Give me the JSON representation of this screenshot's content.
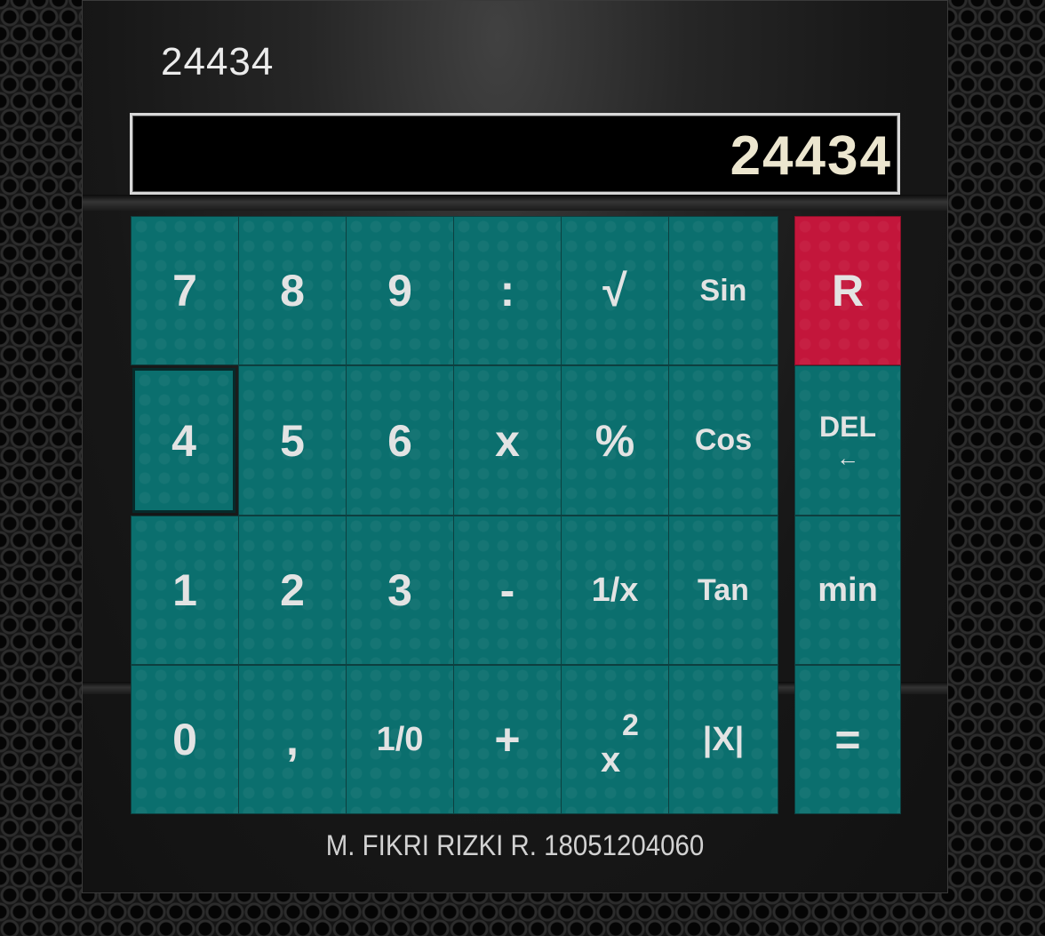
{
  "calculator": {
    "history_value": "24434",
    "display_value": "24434",
    "footer_text": "M. FIKRI RIZKI R. 18051204060",
    "keys": {
      "seven": "7",
      "eight": "8",
      "nine": "9",
      "divide": ":",
      "sqrt": "√",
      "sin": "Sin",
      "reset": "R",
      "four": "4",
      "five": "5",
      "six": "6",
      "multiply": "x",
      "percent": "%",
      "cos": "Cos",
      "del": "DEL",
      "del_arrow": "←",
      "one": "1",
      "two": "2",
      "three": "3",
      "minus": "-",
      "reciprocal": "1/x",
      "tan": "Tan",
      "negate": "min",
      "zero": "0",
      "comma": ",",
      "one_over_zero": "1/0",
      "plus": "+",
      "square_base": "x",
      "square_exp": "2",
      "abs": "|X|",
      "equals": "="
    }
  },
  "colors": {
    "key": "#0b6f6e",
    "reset_key": "#c3163b",
    "display_background": "#000000",
    "display_text": "#ece6cf"
  }
}
